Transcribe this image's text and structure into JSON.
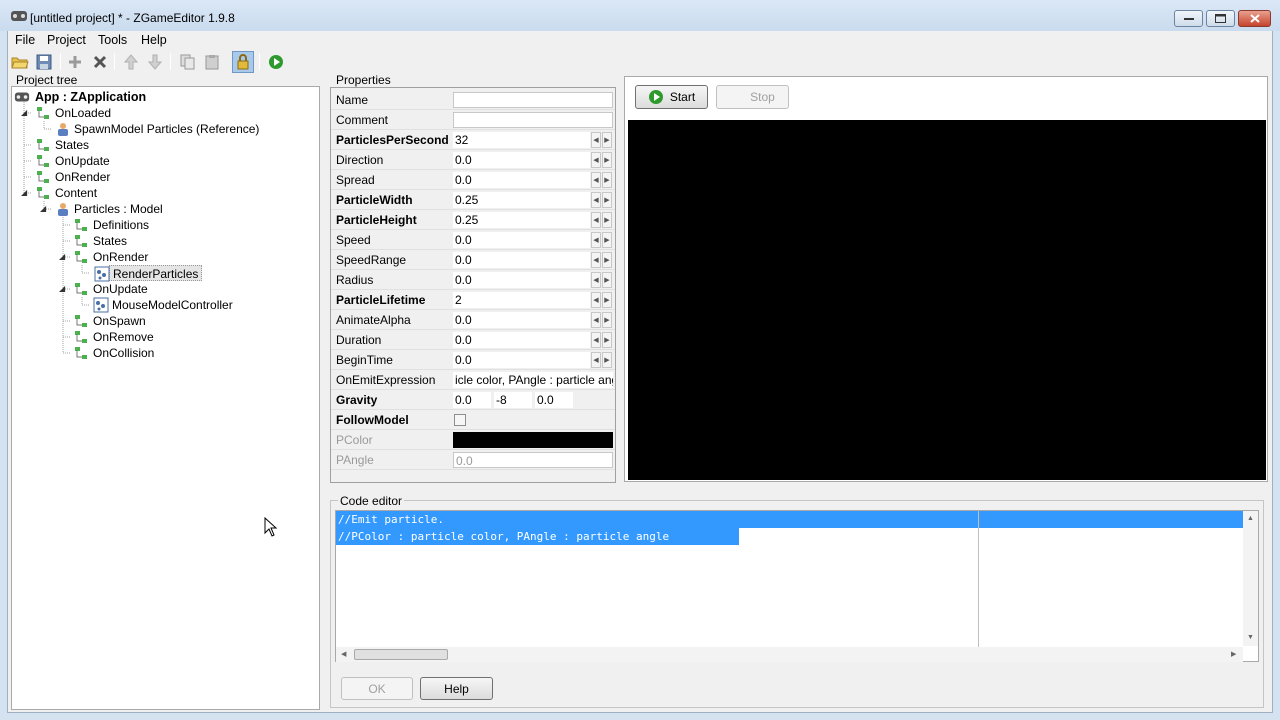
{
  "window": {
    "title": "[untitled project] * - ZGameEditor 1.9.8"
  },
  "menu": [
    "File",
    "Project",
    "Tools",
    "Help"
  ],
  "toolbar": {
    "icons": [
      "open-folder-icon",
      "save-icon",
      "add-icon",
      "delete-icon",
      "move-up-icon",
      "move-down-icon",
      "copy-icon",
      "paste-icon",
      "lock-icon",
      "run-icon"
    ]
  },
  "tree": {
    "label": "Project tree",
    "nodes": [
      {
        "label": "App : ZApplication",
        "bold": true
      },
      {
        "label": "OnLoaded"
      },
      {
        "label": "SpawnModel  Particles (Reference)"
      },
      {
        "label": "States"
      },
      {
        "label": "OnUpdate"
      },
      {
        "label": "OnRender"
      },
      {
        "label": "Content"
      },
      {
        "label": "Particles : Model"
      },
      {
        "label": "Definitions"
      },
      {
        "label": "States"
      },
      {
        "label": "OnRender"
      },
      {
        "label": "RenderParticles"
      },
      {
        "label": "OnUpdate"
      },
      {
        "label": "MouseModelController"
      },
      {
        "label": "OnSpawn"
      },
      {
        "label": "OnRemove"
      },
      {
        "label": "OnCollision"
      }
    ]
  },
  "properties": {
    "label": "Properties",
    "rows": [
      {
        "name": "Name",
        "value": ""
      },
      {
        "name": "Comment",
        "value": ""
      },
      {
        "name": "ParticlesPerSecond",
        "value": "32"
      },
      {
        "name": "Direction",
        "value": "0.0"
      },
      {
        "name": "Spread",
        "value": "0.0"
      },
      {
        "name": "ParticleWidth",
        "value": "0.25"
      },
      {
        "name": "ParticleHeight",
        "value": "0.25"
      },
      {
        "name": "Speed",
        "value": "0.0"
      },
      {
        "name": "SpeedRange",
        "value": "0.0"
      },
      {
        "name": "Radius",
        "value": "0.0"
      },
      {
        "name": "ParticleLifetime",
        "value": "2"
      },
      {
        "name": "AnimateAlpha",
        "value": "0.0"
      },
      {
        "name": "Duration",
        "value": "0.0"
      },
      {
        "name": "BeginTime",
        "value": "0.0"
      },
      {
        "name": "OnEmitExpression",
        "value": "icle color, PAngle : particle angle"
      },
      {
        "name": "Gravity",
        "values": [
          "0.0",
          "-8",
          "0.0"
        ]
      },
      {
        "name": "FollowModel",
        "checked": false
      },
      {
        "name": "PColor",
        "value": ""
      },
      {
        "name": "PAngle",
        "value": "0.0"
      }
    ]
  },
  "preview": {
    "start_label": "Start",
    "stop_label": "Stop"
  },
  "code_editor": {
    "label": "Code editor",
    "lines": [
      "//Emit particle.",
      "//PColor : particle color, PAngle : particle angle"
    ],
    "ok_label": "OK",
    "help_label": "Help"
  },
  "colors": {
    "selection": "#3399ff",
    "preview_bg": "#000000",
    "run_green": "#2e9a2e"
  }
}
